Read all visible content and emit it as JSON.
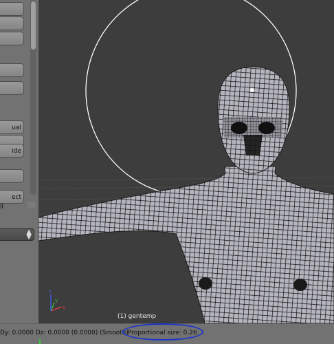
{
  "left_panel": {
    "buttons": [
      "",
      "",
      "",
      "",
      "",
      "ual",
      "",
      "ide",
      "",
      "ect"
    ],
    "label_l": "ll"
  },
  "viewport": {
    "object_label": "(1) gentemp",
    "axis_labels": {
      "x": "x",
      "y": "y",
      "z": "z"
    },
    "colors": {
      "background": "#3d3d3d",
      "mesh_fill": "#b9b9c2",
      "wire": "#111111",
      "circle": "#ffffff"
    }
  },
  "status_bar": {
    "deltas": "Dy: 0.0000  Dz: 0.0000 (0.0000) (Smooth)",
    "proportional_size": "Proportional size: 0.26"
  },
  "annotation": {
    "color": "#1d34c8"
  }
}
